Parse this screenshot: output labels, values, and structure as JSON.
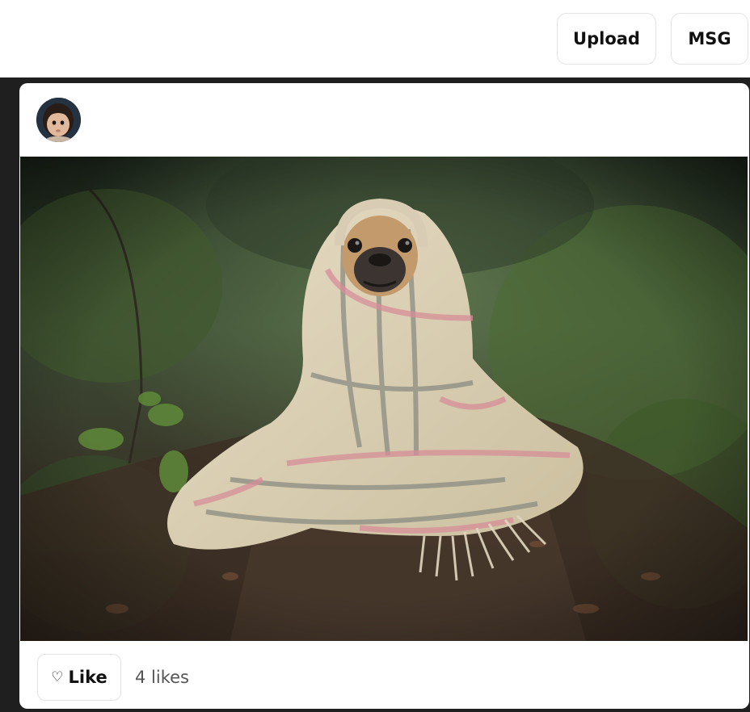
{
  "header": {
    "upload_label": "Upload",
    "msg_label": "MSG"
  },
  "post": {
    "avatar_icon": "user-avatar-child",
    "photo_icon": "pug-in-blanket-photo",
    "like_icon": "♡",
    "like_label": "Like",
    "likes_text": "4 likes"
  },
  "colors": {
    "page_bg": "#ffffff",
    "feed_bg": "#1f1f1f",
    "card_bg": "#ffffff",
    "button_border": "#e3e3e3",
    "text_primary": "#111111",
    "text_secondary": "#555555"
  }
}
